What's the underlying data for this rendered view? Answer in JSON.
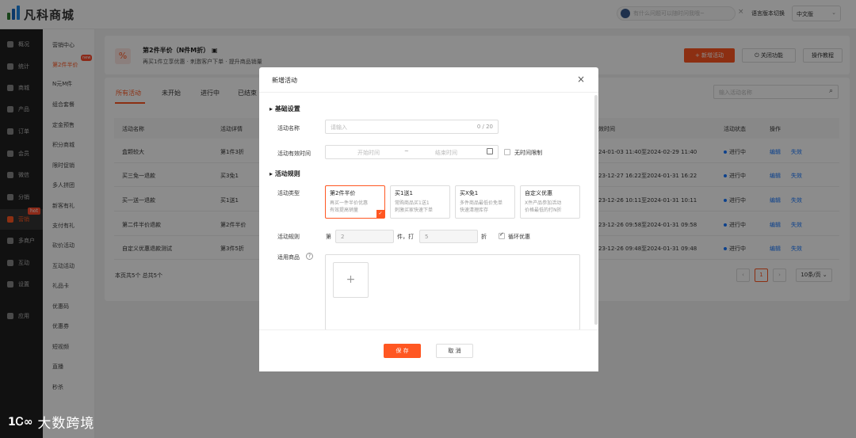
{
  "app": {
    "logo_text": "凡科商城"
  },
  "topbar": {
    "search_placeholder": "有什么问题可以随时问我哦~",
    "close": "×",
    "lang_label": "语言版本切换",
    "lang_value": "中文版",
    "lang_arrow": "⌄"
  },
  "sidebar": {
    "items": [
      {
        "label": "概况",
        "icon": "home-icon"
      },
      {
        "label": "统计",
        "icon": "chart-icon"
      },
      {
        "label": "商城",
        "icon": "shop-icon"
      },
      {
        "label": "产品",
        "icon": "grid-icon"
      },
      {
        "label": "订单",
        "icon": "order-icon"
      },
      {
        "label": "会员",
        "icon": "crown-icon"
      },
      {
        "label": "微信",
        "icon": "wechat-icon"
      },
      {
        "label": "分销",
        "icon": "user-icon"
      },
      {
        "label": "营销",
        "icon": "flag-icon"
      },
      {
        "label": "多商户",
        "icon": "store-icon"
      },
      {
        "label": "互动",
        "icon": "interact-icon"
      },
      {
        "label": "设置",
        "icon": "gear-icon"
      },
      {
        "label": "应用",
        "icon": "apps-icon"
      }
    ],
    "hot_badge": "hot"
  },
  "subnav": {
    "items": [
      "营销中心",
      "第2件半价",
      "N元M件",
      "组合套餐",
      "定金预售",
      "积分商城",
      "限时促销",
      "多人拼团",
      "新客有礼",
      "支付有礼",
      "砍价活动",
      "互动活动",
      "礼品卡",
      "优惠码",
      "优惠券",
      "短视频",
      "直播",
      "秒杀"
    ],
    "new_badge": "new"
  },
  "page_header": {
    "icon": "%",
    "title": "第2件半价（N件M折）",
    "badge": "▣",
    "subtitle": "再买1件立享优惠 · 刺激客户下单 · 提升商品销量",
    "add_button": "+ 新增活动",
    "close_button": "⏻ 关闭功能",
    "help_button": "操作教程"
  },
  "tabs": [
    "所有活动",
    "未开始",
    "进行中",
    "已结束"
  ],
  "search": {
    "placeholder": "输入活动名称",
    "icon": "search-icon"
  },
  "table": {
    "headers": [
      "活动名称",
      "活动详情",
      "效时间",
      "活动状态",
      "操作"
    ],
    "rows": [
      {
        "name": "盒颗较大",
        "detail": "第1件3折",
        "time": "24-01-03 11:40至2024-02-29 11:40",
        "status": "进行中",
        "edit": "编辑",
        "disable": "失效"
      },
      {
        "name": "买三免一退款",
        "detail": "买3免1",
        "time": "23-12-27 16:22至2024-01-31 16:22",
        "status": "进行中",
        "edit": "编辑",
        "disable": "失效"
      },
      {
        "name": "买一送一退款",
        "detail": "买1送1",
        "time": "23-12-26 10:11至2024-01-31 10:11",
        "status": "进行中",
        "edit": "编辑",
        "disable": "失效"
      },
      {
        "name": "第二件半价退款",
        "detail": "第2件半价",
        "time": "23-12-26 09:58至2024-01-31 09:58",
        "status": "进行中",
        "edit": "编辑",
        "disable": "失效"
      },
      {
        "name": "自定义优惠退款测试",
        "detail": "第3件5折",
        "time": "23-12-26 09:48至2024-01-31 09:48",
        "status": "进行中",
        "edit": "编辑",
        "disable": "失效"
      }
    ],
    "footer": "本页共5个 总共5个"
  },
  "pagination": {
    "prev": "‹",
    "page": "1",
    "next": "›",
    "size": "10条/页 ⌄"
  },
  "modal": {
    "title": "新增活动",
    "close": "×",
    "section_basic": "基础设置",
    "name_label": "活动名称",
    "name_placeholder": "请输入",
    "name_count": "0 / 20",
    "period_label": "活动有效时间",
    "start_placeholder": "开始时间",
    "range_sep": "~",
    "end_placeholder": "结束时间",
    "no_limit": "无时间限制",
    "section_rules": "活动规则",
    "type_label": "活动类型",
    "types": [
      {
        "title": "第2件半价",
        "desc1": "再买一件半价优惠",
        "desc2": "有效提高销量"
      },
      {
        "title": "买1送1",
        "desc1": "常购商品买1送1",
        "desc2": "刺激买家快速下单"
      },
      {
        "title": "买X免1",
        "desc1": "多件商品最低价免单",
        "desc2": "快速清理库存"
      },
      {
        "title": "自定义优惠",
        "desc1": "X件产品参加活动",
        "desc2": "价格最低的打N折"
      }
    ],
    "rule_label": "活动规则",
    "rule_prefix": "第",
    "rule_qty": "2",
    "rule_mid": "件，打",
    "rule_discount": "5",
    "rule_suffix": "折",
    "loop_label": "循环优惠",
    "goods_label": "适用商品",
    "goods_help": "?",
    "plus": "+",
    "save": "保 存",
    "cancel": "取 消"
  },
  "watermark": {
    "logo": "1Ꮯ∞",
    "text": "大数跨境"
  }
}
